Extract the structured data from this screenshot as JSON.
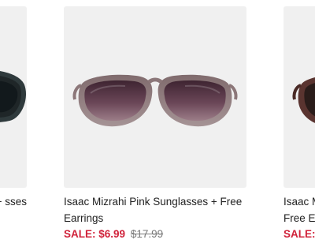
{
  "products": [
    {
      "title_fragment": "sses +",
      "frame_color": "#2f3a3c"
    },
    {
      "title": "Isaac Mizrahi Pink Sunglasses + Free Earrings",
      "sale_label": "SALE:",
      "sale_price": "$6.99",
      "original_price": "$17.99",
      "frame_color": "#8c7779",
      "lens_color": "#5b3a48"
    },
    {
      "title_fragment_line1": "Isaac M",
      "title_fragment_line2": "Free E",
      "sale_label": "SALE:",
      "frame_color": "#4a2a26"
    }
  ],
  "colors": {
    "sale": "#d0223a",
    "original_price": "#7a7a7a",
    "image_bg": "#f0f0f0",
    "text": "#222222"
  }
}
